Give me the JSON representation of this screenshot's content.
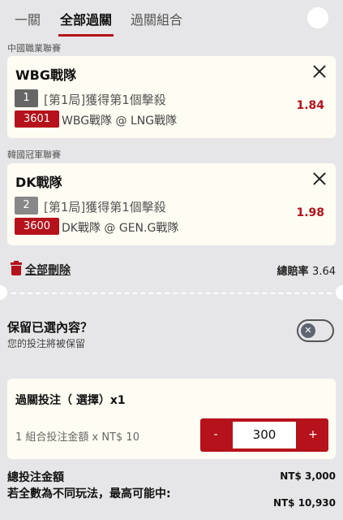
{
  "tabs": [
    {
      "label": "一關"
    },
    {
      "label": "全部過關"
    },
    {
      "label": "過關組合"
    }
  ],
  "bets": [
    {
      "league": "中國職業聯賽",
      "team": "WBG戰隊",
      "number": "1",
      "market": "[第1局]獲得第1個擊殺",
      "match_code": "3601",
      "match": "WBG戰隊 @ LNG戰隊",
      "odds": "1.84"
    },
    {
      "league": "韓國冠軍聯賽",
      "team": "DK戰隊",
      "number": "2",
      "market": "[第1局]獲得第1個擊殺",
      "match_code": "3600",
      "match": "DK戰隊 @ GEN.G戰隊",
      "odds": "1.98"
    }
  ],
  "actions": {
    "delete_all": "全部刪除",
    "total_odds_label": "總賠率",
    "total_odds_value": "3.64"
  },
  "keep": {
    "title": "保留已選內容？",
    "subtitle": "您的投注將被保留",
    "toggle_knob": "✕"
  },
  "parlay": {
    "title": "過關投注（ 選擇）x1",
    "unit_label": "1 組合投注金額 x NT$ 10",
    "minus": "-",
    "plus": "+",
    "amount": "300"
  },
  "summary": {
    "total_label": "總投注金額",
    "total_value": "NT$ 3,000",
    "max_label": "若全數為不同玩法，最高可能中:",
    "max_value": "NT$ 10,930"
  },
  "colors": {
    "accent": "#b5121b",
    "background": "#e6e6e8",
    "card": "#fffdf3"
  }
}
